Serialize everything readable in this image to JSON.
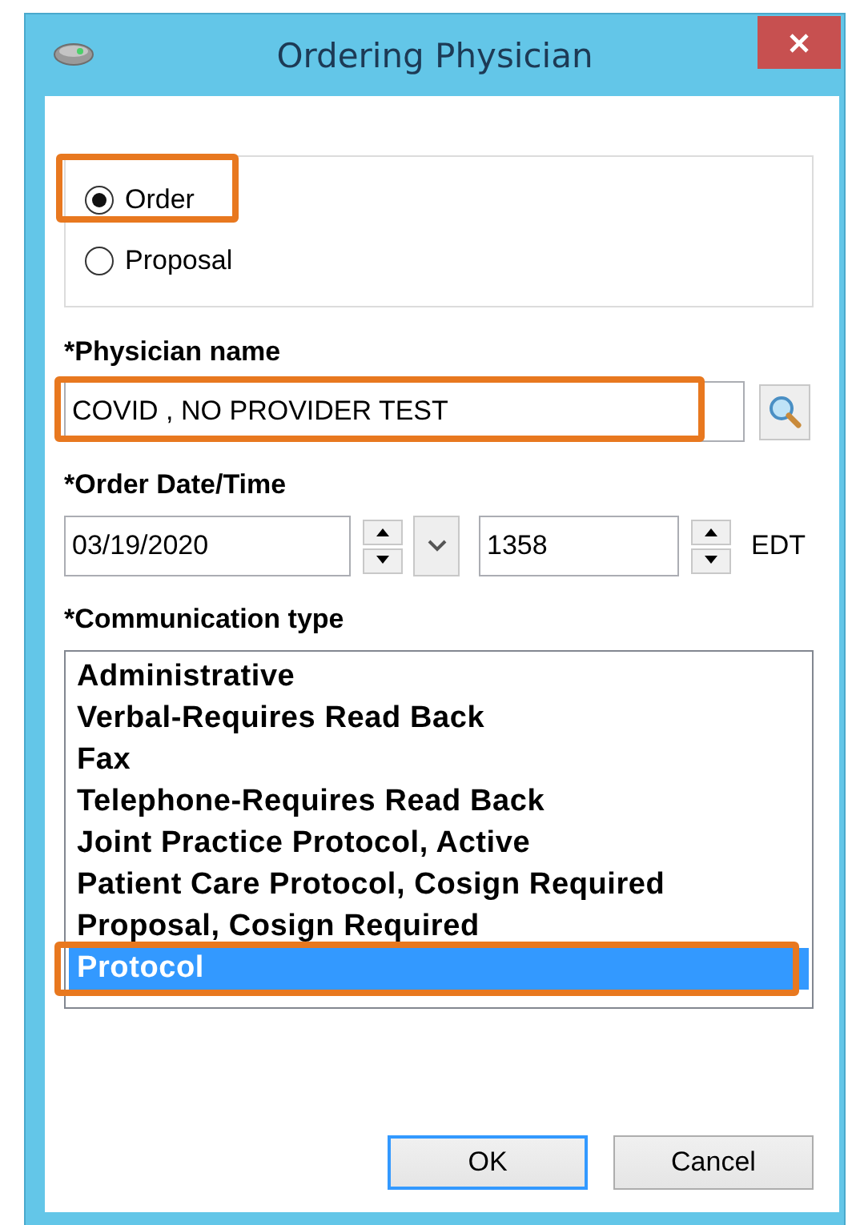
{
  "window": {
    "title": "Ordering Physician"
  },
  "order_type": {
    "options": [
      {
        "label": "Order",
        "selected": true,
        "highlighted": true
      },
      {
        "label": "Proposal",
        "selected": false,
        "highlighted": false
      }
    ]
  },
  "physician_name": {
    "label": "*Physician name",
    "value": "COVID , NO PROVIDER TEST",
    "highlighted": true
  },
  "order_datetime": {
    "label": "*Order Date/Time",
    "date": "03/19/2020",
    "time": "1358",
    "timezone": "EDT"
  },
  "communication_type": {
    "label": "*Communication type",
    "items": [
      {
        "label": "Administrative",
        "selected": false,
        "highlighted": false
      },
      {
        "label": "Verbal-Requires Read Back",
        "selected": false,
        "highlighted": false
      },
      {
        "label": "Fax",
        "selected": false,
        "highlighted": false
      },
      {
        "label": "Telephone-Requires Read Back",
        "selected": false,
        "highlighted": false
      },
      {
        "label": "Joint Practice Protocol, Active",
        "selected": false,
        "highlighted": false
      },
      {
        "label": "Patient Care Protocol, Cosign Required",
        "selected": false,
        "highlighted": false
      },
      {
        "label": "Proposal, Cosign Required",
        "selected": false,
        "highlighted": false
      },
      {
        "label": "Protocol",
        "selected": true,
        "highlighted": true
      }
    ]
  },
  "buttons": [
    {
      "label": "OK",
      "default": true
    },
    {
      "label": "Cancel",
      "default": false
    }
  ]
}
